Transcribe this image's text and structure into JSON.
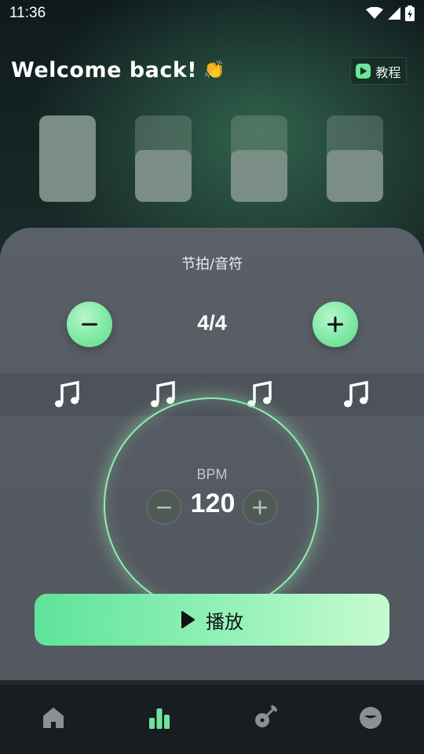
{
  "status_bar": {
    "time": "11:36",
    "icons": [
      "wifi-icon",
      "signal-icon",
      "battery-charging-icon"
    ]
  },
  "header": {
    "title": "Welcome back!",
    "emoji": "👏",
    "tutorial_label": "教程"
  },
  "beat_cards": [
    {
      "level": 1.0
    },
    {
      "level": 0.6
    },
    {
      "level": 0.6
    },
    {
      "level": 0.6
    }
  ],
  "metronome": {
    "section_title": "节拍/音符",
    "time_signature": "4/4",
    "notes": [
      "music-note-icon",
      "music-note-icon",
      "music-note-icon",
      "music-note-icon"
    ],
    "bpm_label": "BPM",
    "bpm_value": "120",
    "play_label": "播放"
  },
  "bottom_nav": {
    "items": [
      {
        "icon": "home-icon",
        "active": false
      },
      {
        "icon": "bar-chart-icon",
        "active": true
      },
      {
        "icon": "guitar-icon",
        "active": false
      },
      {
        "icon": "face-icon",
        "active": false
      }
    ]
  },
  "colors": {
    "accent": "#7fe9a5",
    "panel": "#5b6068",
    "nav_active": "#6de59e",
    "nav_inactive": "#8a9095"
  }
}
